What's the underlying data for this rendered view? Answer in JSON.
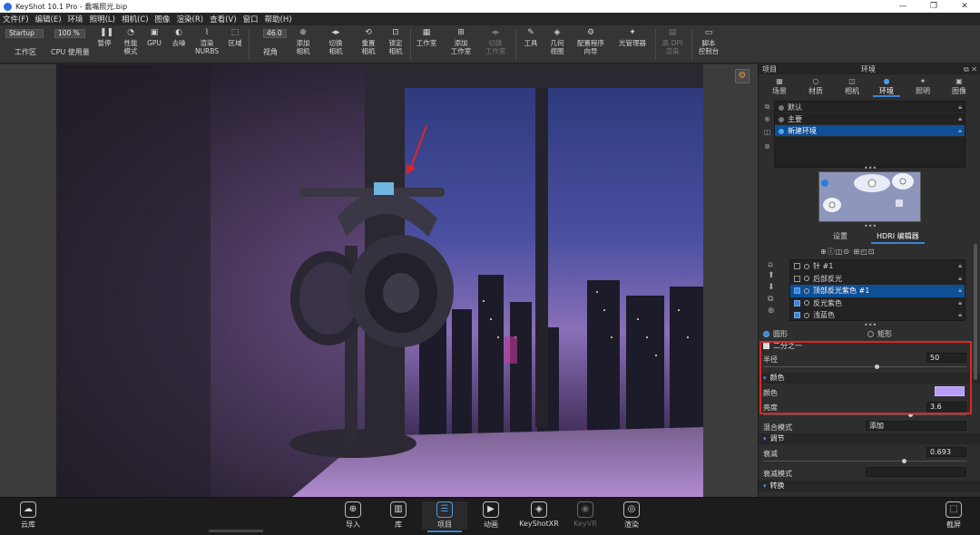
{
  "window": {
    "title": "KeyShot 10.1 Pro  -  蠢嘴照光.bip",
    "controls": [
      "—",
      "❐",
      "✕"
    ]
  },
  "menu": [
    "文件(F)",
    "编辑(E)",
    "环境",
    "照明(L)",
    "相机(C)",
    "图像",
    "渲染(R)",
    "查看(V)",
    "窗口",
    "帮助(H)"
  ],
  "toolbar": {
    "workspace_value": "Startup",
    "workspace_label": "工作区",
    "cpu_value": "100 %",
    "cpu_label": "CPU 使用量",
    "pause": "暂停",
    "perf_mode": "性能\n模式",
    "gpu": "GPU",
    "denoise": "去噪",
    "render_nurbs": "渲染\nNURBS",
    "region": "区域",
    "fov_value": "46.0",
    "fov_label": "视角",
    "add_camera": "添加\n相机",
    "switch_camera": "切换\n相机",
    "reset_camera": "重置\n相机",
    "lock_camera": "锁定\n相机",
    "studio": "工作室",
    "add_studio": "添加\n工作室",
    "switch_studio": "切换\n工作室",
    "tools": "工具",
    "geometry_view": "几何\n视图",
    "config_wizard": "配置程序\n向导",
    "light_manager": "光管理器",
    "dpi_render": "高 DPI\n渲染",
    "script_console": "脚本\n控制台"
  },
  "panel": {
    "header_left": "项目",
    "header_center": "环境",
    "tabs": [
      "场景",
      "材质",
      "相机",
      "环境",
      "照明",
      "图像"
    ],
    "environments": [
      "默认",
      "主要",
      "新建环境"
    ],
    "subtabs": [
      "设置",
      "HDRI 编辑器"
    ],
    "pin_icons": "⊕ⓘ◫⊙ ⊞◰⊡",
    "lights": [
      {
        "name": "针 #1",
        "checked": false
      },
      {
        "name": "后部反光",
        "checked": false
      },
      {
        "name": "顶部反光紫色 #1",
        "checked": true
      },
      {
        "name": "反光紫色",
        "checked": true
      },
      {
        "name": "浅蓝色",
        "checked": true
      }
    ],
    "shape_circle": "圆形",
    "shape_rect": "矩形",
    "half_label": "二分之一",
    "radius_label": "半径",
    "radius_value": "50",
    "color_section": "颜色",
    "color_label": "颜色",
    "color_hex": "#b79cf6",
    "brightness_label": "亮度",
    "brightness_value": "3.6",
    "blend_label": "混合模式",
    "blend_value": "添加",
    "adjust_section": "调节",
    "falloff_label": "衰减",
    "falloff_value": "0.693",
    "falloff_mode_label": "衰减模式",
    "transform_section": "转换"
  },
  "bottom": {
    "cloud": "云库",
    "import": "导入",
    "library": "库",
    "project": "项目",
    "animation": "动画",
    "keyshotxr": "KeyShotXR",
    "keyvr": "KeyVR",
    "render": "渲染",
    "screenshot": "截屏"
  }
}
